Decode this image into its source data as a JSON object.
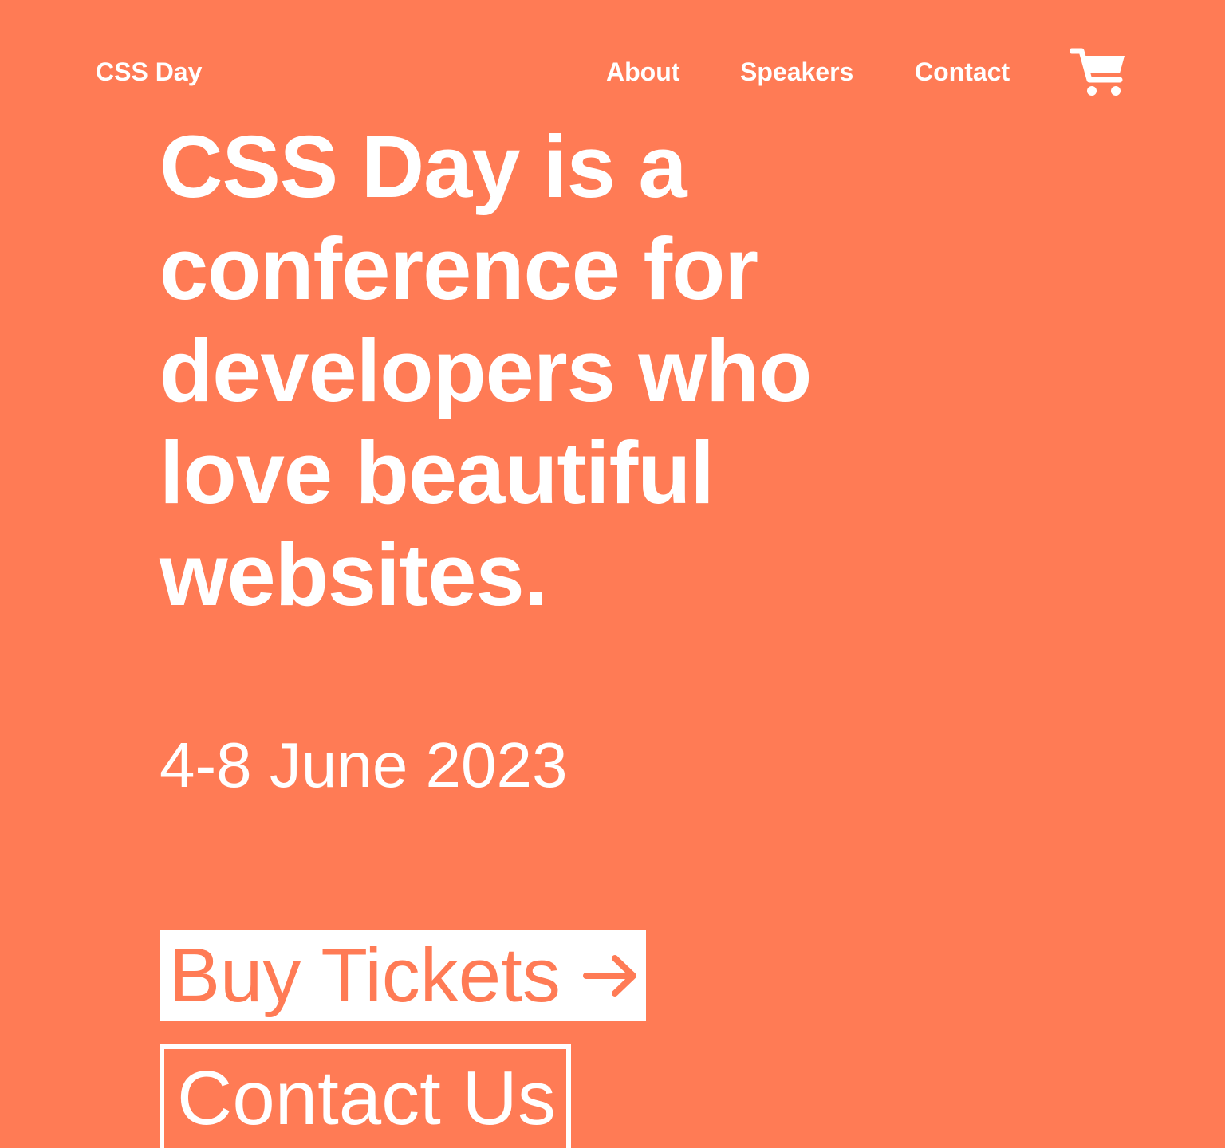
{
  "colors": {
    "background": "#FF7B55",
    "text": "#FFFFFF",
    "button_fill": "#FFFFFF",
    "button_text": "#FF7B55"
  },
  "header": {
    "brand": "CSS Day",
    "nav": {
      "about": "About",
      "speakers": "Speakers",
      "contact": "Contact"
    },
    "cart_icon": "shopping-cart-icon"
  },
  "hero": {
    "title": "CSS Day is a conference for developers who love beautiful websites.",
    "date": "4-8 June 2023",
    "buy_button": {
      "label": "Buy Tickets",
      "icon": "arrow-right-icon"
    },
    "contact_button": {
      "label": "Contact Us"
    }
  }
}
